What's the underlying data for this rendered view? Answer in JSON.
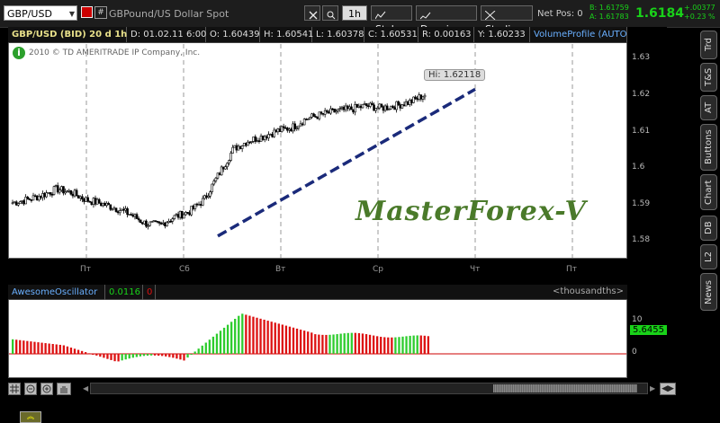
{
  "toolbar": {
    "symbol": "GBP/USD",
    "description": "GBPound/US Dollar Spot",
    "timeframe": "1h",
    "style_label": "Style",
    "drawings_label": "Drawings",
    "studies_label": "Studies",
    "netpos": "Net Pos: 0",
    "bid": "B: 1.61759",
    "ask": "A: 1.61783",
    "last": "1.6184",
    "change": "+.00377",
    "change_pct": "+0.23 %"
  },
  "infobar": {
    "title": "GBP/USD (BID) 20 d 1h",
    "date": "D: 01.02.11 6:00",
    "open": "O: 1.60439",
    "high": "H: 1.60541",
    "low": "L: 1.60378",
    "close": "C: 1.60531",
    "range": "R: 0.00163",
    "y": "Y: 1.60233",
    "volume_profile": "VolumeProfile (AUTO..."
  },
  "copyright": "2010 © TD AMERITRADE IP Company, Inc.",
  "hi_label": "Hi: 1.62118",
  "watermark": "MasterForex-V",
  "price_axis": [
    "1.63",
    "1.62",
    "1.61",
    "1.6",
    "1.59",
    "1.58"
  ],
  "time_axis": [
    "Пт",
    "Сб",
    "Вт",
    "Ср",
    "Чт",
    "Пт"
  ],
  "osc": {
    "name": "AwesomeOscillator",
    "value": "0.0116",
    "zero": "0",
    "units": "<thousandths>",
    "axis_top": "10",
    "axis_zero": "0",
    "current": "5.6455"
  },
  "side_tabs": [
    "Trd",
    "T&S",
    "AT",
    "Buttons",
    "Chart",
    "DB",
    "L2",
    "News"
  ],
  "colors": {
    "up": "#2ecc2e",
    "down": "#dd1111",
    "trend_line": "#1a2a7a",
    "accent_green": "#19d219",
    "watermark": "#4a7a2a"
  },
  "chart_data": {
    "type": "candlestick",
    "series": [
      {
        "name": "GBP/USD",
        "values": [
          1.5897,
          1.5905,
          1.5918,
          1.5935,
          1.5925,
          1.5905,
          1.5895,
          1.5882,
          1.5865,
          1.584,
          1.5835,
          1.5858,
          1.5872,
          1.5905,
          1.5975,
          1.6045,
          1.6068,
          1.608,
          1.6095,
          1.6105,
          1.613,
          1.614,
          1.615,
          1.6155,
          1.6165,
          1.6158,
          1.6165,
          1.6175,
          1.6195
        ]
      }
    ],
    "ylim": [
      1.575,
      1.633
    ],
    "high": 1.62118,
    "trendline": {
      "start_price": 1.5805,
      "end_price": 1.621
    }
  }
}
